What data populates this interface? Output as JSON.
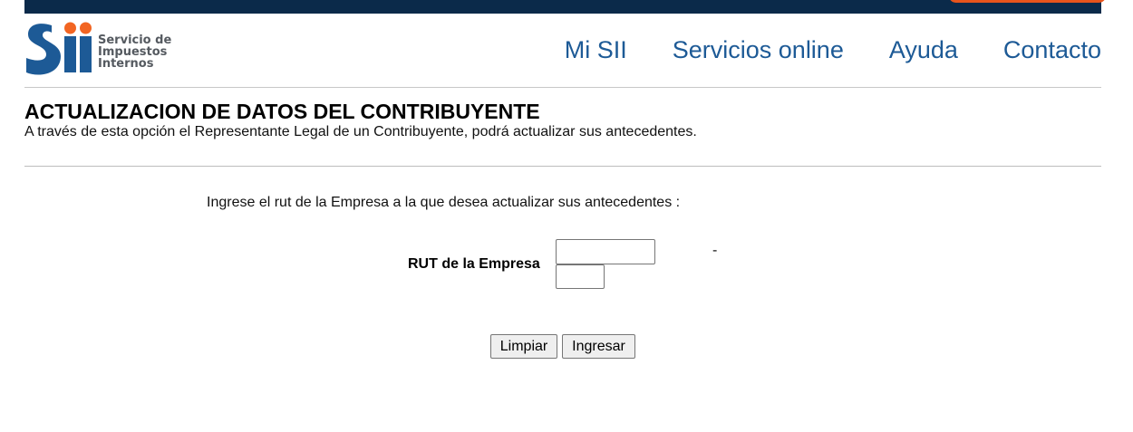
{
  "colors": {
    "top_bar": "#0b2a4a",
    "accent_orange": "#e8541c",
    "nav_link": "#1d5a96",
    "logo_blue": "#1d5a96",
    "logo_orange": "#f26522"
  },
  "logo": {
    "mark": "Sii",
    "line1": "Servicio de",
    "line2": "Impuestos",
    "line3": "Internos"
  },
  "nav": {
    "items": [
      {
        "label": "Mi SII"
      },
      {
        "label": "Servicios online"
      },
      {
        "label": "Ayuda"
      },
      {
        "label": "Contacto"
      }
    ]
  },
  "page": {
    "title": "ACTUALIZACION DE DATOS DEL CONTRIBUYENTE",
    "description": "A través de esta opción el Representante Legal de un Contribuyente, podrá actualizar sus antecedentes."
  },
  "form": {
    "instruction": "Ingrese el rut de la Empresa a la que desea actualizar sus antecedentes :",
    "rut_label": "RUT de la Empresa",
    "rut_value": "",
    "dv_value": "",
    "separator": "-",
    "clear_label": "Limpiar",
    "submit_label": "Ingresar"
  }
}
